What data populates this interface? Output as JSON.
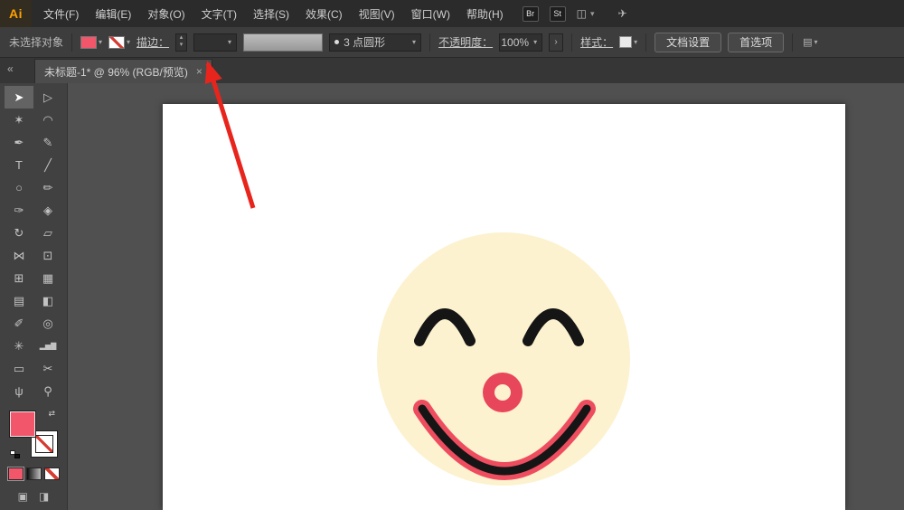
{
  "menubar": {
    "logo": "Ai",
    "items": [
      "文件(F)",
      "编辑(E)",
      "对象(O)",
      "文字(T)",
      "选择(S)",
      "效果(C)",
      "视图(V)",
      "窗口(W)",
      "帮助(H)"
    ],
    "br_badge": "Br",
    "st_badge": "St",
    "workspace_icon": "◫",
    "workspace_caret": "▾",
    "gpu_icon": "✈"
  },
  "controlbar": {
    "no_selection": "未选择对象",
    "fill_caret": "▾",
    "stroke_caret": "▾",
    "stroke_label": "描边：",
    "stepper_up": "▴",
    "stepper_down": "▾",
    "stroke_width_value": "",
    "width_caret": "▾",
    "brush_dot": "•",
    "brush_value": "3 点圆形",
    "brush_caret": "▾",
    "opacity_label": "不透明度：",
    "opacity_value": "100%",
    "opacity_caret": "▾",
    "opacity_panel_btn": "›",
    "style_label": "样式：",
    "style_caret": "▾",
    "document_setup_btn": "文档设置",
    "preferences_btn": "首选项",
    "panel_menu_icon": "▤",
    "panel_menu_caret": "▾"
  },
  "tabbar": {
    "collapse_icon": "«",
    "tab_title": "未标题-1* @ 96% (RGB/预览)",
    "close_icon": "×"
  },
  "toolbar": {
    "tools": [
      {
        "name": "selection-tool",
        "glyph": "➤"
      },
      {
        "name": "direct-selection-tool",
        "glyph": "▷"
      },
      {
        "name": "magic-wand-tool",
        "glyph": "✶"
      },
      {
        "name": "lasso-tool",
        "glyph": "◠"
      },
      {
        "name": "pen-tool",
        "glyph": "✒"
      },
      {
        "name": "curvature-tool",
        "glyph": "✎"
      },
      {
        "name": "type-tool",
        "glyph": "T"
      },
      {
        "name": "line-tool",
        "glyph": "╱"
      },
      {
        "name": "ellipse-tool",
        "glyph": "○"
      },
      {
        "name": "paintbrush-tool",
        "glyph": "✏"
      },
      {
        "name": "shaper-tool",
        "glyph": "✑"
      },
      {
        "name": "eraser-tool",
        "glyph": "◈"
      },
      {
        "name": "rotate-tool",
        "glyph": "↻"
      },
      {
        "name": "scale-tool",
        "glyph": "▱"
      },
      {
        "name": "width-tool",
        "glyph": "⋈"
      },
      {
        "name": "free-transform-tool",
        "glyph": "⊡"
      },
      {
        "name": "shape-builder-tool",
        "glyph": "⊞"
      },
      {
        "name": "perspective-grid-tool",
        "glyph": "▦"
      },
      {
        "name": "mesh-tool",
        "glyph": "▤"
      },
      {
        "name": "gradient-tool",
        "glyph": "◧"
      },
      {
        "name": "eyedropper-tool",
        "glyph": "✐"
      },
      {
        "name": "blend-tool",
        "glyph": "◎"
      },
      {
        "name": "symbol-sprayer-tool",
        "glyph": "✳"
      },
      {
        "name": "graph-tool",
        "glyph": "▂▅▇"
      },
      {
        "name": "artboard-tool",
        "glyph": "▭"
      },
      {
        "name": "slice-tool",
        "glyph": "✂"
      },
      {
        "name": "hand-tool",
        "glyph": "ψ"
      },
      {
        "name": "zoom-tool",
        "glyph": "⚲"
      }
    ],
    "swap_icon": "⇄"
  },
  "colors": {
    "logo_accent": "#ffa200",
    "fill_pink": "#f2566b",
    "face_cream": "#fdf2cf",
    "nose_red": "#e8465a",
    "mouth_pink": "#ee4d5f",
    "ink": "#151515",
    "none_slash_red": "#d63a30",
    "annotation_red": "#e8251d"
  }
}
